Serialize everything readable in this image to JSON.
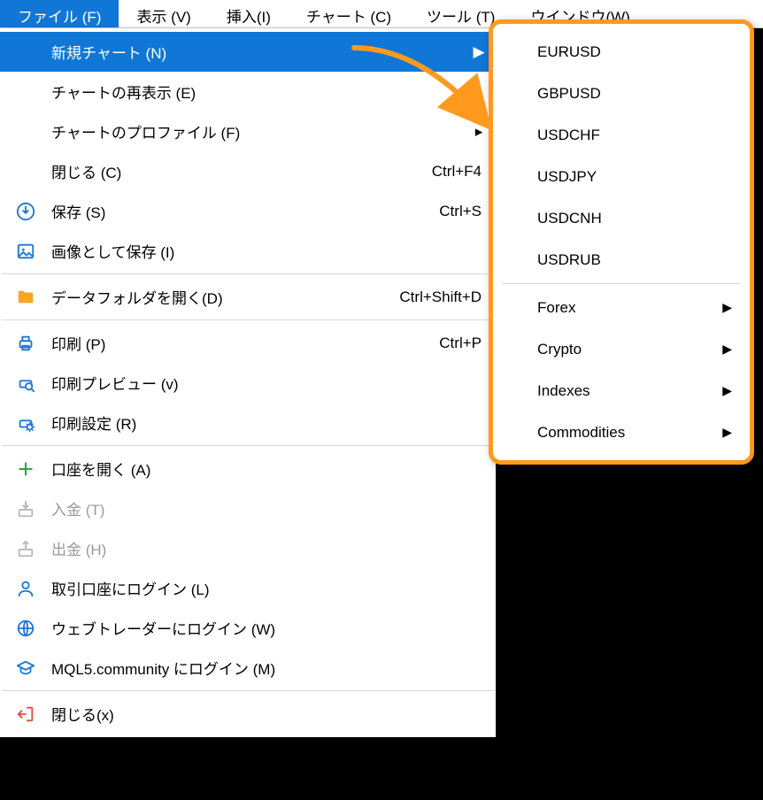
{
  "menubar": {
    "file": "ファイル (F)",
    "view": "表示 (V)",
    "insert": "挿入(I)",
    "chart": "チャート (C)",
    "tools": "ツール (T)",
    "window": "ウインドウ(W)"
  },
  "file_menu": {
    "new_chart": "新規チャート (N)",
    "reshow_chart": "チャートの再表示 (E)",
    "chart_profile": "チャートのプロファイル (F)",
    "close": "閉じる (C)",
    "close_sc": "Ctrl+F4",
    "save": "保存 (S)",
    "save_sc": "Ctrl+S",
    "save_image": "画像として保存 (I)",
    "open_data_folder": "データフォルダを開く(D)",
    "open_data_sc": "Ctrl+Shift+D",
    "print": "印刷 (P)",
    "print_sc": "Ctrl+P",
    "print_preview": "印刷プレビュー (v)",
    "print_setup": "印刷設定 (R)",
    "open_account": "口座を開く (A)",
    "deposit": "入金 (T)",
    "withdraw": "出金 (H)",
    "login_trade": "取引口座にログイン (L)",
    "login_web": "ウェブトレーダーにログイン (W)",
    "login_mql5": "MQL5.community にログイン (M)",
    "exit": "閉じる(x)"
  },
  "submenu": {
    "eurusd": "EURUSD",
    "gbpusd": "GBPUSD",
    "usdchf": "USDCHF",
    "usdjpy": "USDJPY",
    "usdcnh": "USDCNH",
    "usdrub": "USDRUB",
    "forex": "Forex",
    "crypto": "Crypto",
    "indexes": "Indexes",
    "commodities": "Commodities"
  }
}
